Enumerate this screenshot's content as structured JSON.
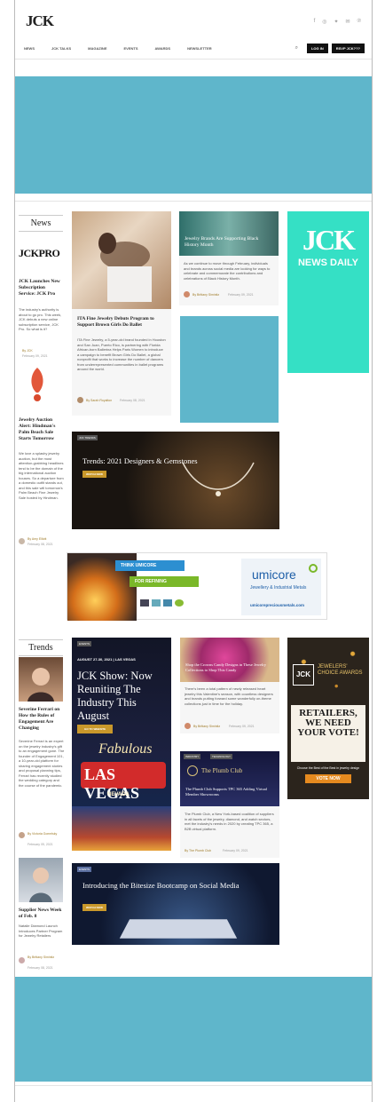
{
  "header": {
    "logo": "JCK",
    "social_icons": [
      "facebook-icon",
      "instagram-icon",
      "twitter-icon",
      "email-icon",
      "pinterest-icon"
    ],
    "social_glyphs": [
      "f",
      "◎",
      "✦",
      "✉",
      "℗"
    ],
    "nav": [
      "NEWS",
      "JCK TALKS",
      "MAGAZINE",
      "EVENTS",
      "AWARDS",
      "NEWSLETTER"
    ],
    "login_label": "LOG IN",
    "rsvp_label": "RSVP JCK???"
  },
  "colors": {
    "ad_blue": "#5fb6cb",
    "teal": "#35e0c5",
    "gold": "#c9982b"
  },
  "news": {
    "heading": "News",
    "jckpro_logo": "JCKPRO",
    "item1_title": "JCK Launches New Subscription Service: JCK Pro",
    "item1_text": "The industry's authority is about to go pro. This week, JCK debuts a new online subscription service, JCK Pro. So what is it?",
    "item1_by": "By JCK",
    "item1_date": "February 09, 2021",
    "item2_title": "Jewelry Auction Alert: Hindman's Palm Beach Sale Starts Tomorrow",
    "item2_text": "We love a splashy jewelry auction, but the most attention-grabbing headlines tend to be the domain of the big international auction houses. So a departure from a domestic outfit stands out, and this sale will tomorrow's Palm Beach Fine Jewelry Sale hosted by Hindman.",
    "item2_by": "By Amy Elliott",
    "item2_date": "February 08, 2021"
  },
  "feature": {
    "title": "ITA Fine Jewelry Debuts Program to Support Brown Girls Do Ballet",
    "text": "ITA Fine Jewelry, a 5-year-old brand founded in Houston and San Juan, Puerto Rico, is partnering with Florida African-born Ballerina Helps Paris Women to introduce a campaign to benefit Brown Girls Do Ballet, a global nonprofit that works to increase the number of dancers from underrepresented communities in ballet programs around the world.",
    "by": "By Sarah Royalton",
    "date": "February 08, 2021"
  },
  "black_history": {
    "title": "Jewelry Brands Are Supporting Black History Month",
    "text": "As we continue to move through February, individuals and brands across social media are looking for ways to celebrate and commemorate the contributions and celebrations of Black History Month.",
    "by": "By Brittany Siminitz",
    "date": "February 09, 2021"
  },
  "jck_news_daily": {
    "line1": "JCK",
    "line2": "NEWS DAILY"
  },
  "trends_banner": {
    "badge": "JCK TRENDS",
    "title": "Trends: 2021 Designers & Gemstones",
    "button": "WATCH NOW"
  },
  "umicore_ad": {
    "think": "THINK UMICORE",
    "refining": "FOR REFINING",
    "brand": "umicore",
    "tagline": "Jewellery & Industrial Metals",
    "url": "umicorepreciousmetals.com"
  },
  "trends": {
    "heading": "Trends",
    "item1_title": "Severine Ferrari on How the Rules of Engagement Are Changing",
    "item1_text": "Severine Ferrari is an expert on the jewelry industry's gift to an engagement gone. The founder of Engagement 101, a 10-year-old platform for sharing engagement stories and proposal planning tips, Ferrari has recently studied the wedding category and the course of the pandemic.",
    "item1_by": "By Victoria Gomelsky",
    "item1_date": "February 05, 2021",
    "item2_title": "Supplier News Week of Feb. 8",
    "item2_text": "Natalie Diamond Launch Introduces Partner Program for Jewelry Retailers",
    "item2_by": "By Brittany Siminitz",
    "item2_date": "February 08, 2021"
  },
  "jck_show": {
    "badge": "EVENTS",
    "date": "AUGUST 27-30, 2021 | LAS VEGAS",
    "title": "JCK Show: Now Reuniting The Industry This August",
    "button": "GO TO WEBSITE",
    "sign_line1": "Fabulous",
    "sign_line2": "LAS VEGAS",
    "sign_line3": "NEVADA"
  },
  "candy": {
    "title": "Shop the Crowns Candy Designs in These Jewelry Collections to Shop This Candy",
    "text": "There's been a total pattern of newly released heart jewelry this Valentine's season, with countless designers and brands putting forward some wonderfully on-theme collections just in time for the holiday.",
    "by": "By Brittany Siminitz",
    "date": "February 09, 2021"
  },
  "plumb_club": {
    "badge1": "INDUSTRY",
    "badge2": "TECHNOLOGY",
    "logo": "The Plumb Club",
    "title": "The Plumb Club Supports TPC 365 Adding Virtual Member Showrooms",
    "text": "The Plumb Club, a New York-based coalition of suppliers in all facets of the jewelry, diamond, and watch sectors, met the industry's needs in 2020 by creating TPC 365, a B2B virtual platform.",
    "by": "By The Plumb Club",
    "date": "February 09, 2021"
  },
  "awards_ad": {
    "jck": "JCK",
    "jewelers_choice": "JEWELERS' CHOICE AWARDS",
    "retailers": "RETAILERS, WE NEED YOUR VOTE!",
    "sub": "Choose the Best of the Best in jewelry design",
    "button": "VOTE NOW"
  },
  "bootcamp": {
    "badge": "EVENTS",
    "title": "Introducing the Bitesize Bootcamp on Social Media",
    "button": "WATCH NOW"
  }
}
